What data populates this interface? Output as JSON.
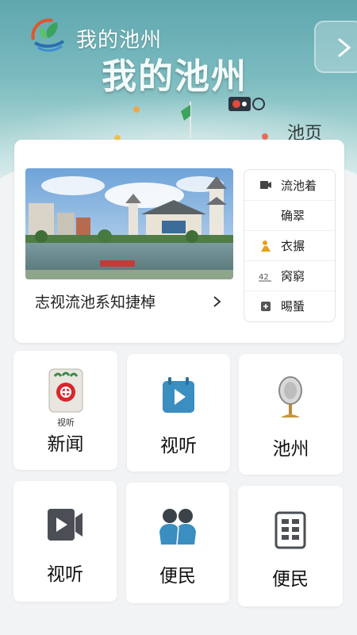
{
  "header": {
    "title_small": "我的池州",
    "title_big": "我的池州",
    "sub_title": "池页",
    "colors": {
      "sky": "#5fa7ae",
      "accent_green": "#3aa35c"
    },
    "icons": [
      "logo-icon",
      "next-arrow-icon",
      "flag-icon",
      "record-icon"
    ]
  },
  "featured": {
    "caption": "志视流池系知捷棹",
    "side_menu": [
      {
        "icon": "video-camera-icon",
        "label": "流池着"
      },
      {
        "icon": "",
        "label": "确翠"
      },
      {
        "icon": "person-icon",
        "label": "衣搌"
      },
      {
        "icon": "number-icon",
        "label": "窉窮"
      },
      {
        "icon": "plus-box-icon",
        "label": "晹蜑"
      }
    ]
  },
  "grid": [
    {
      "label": "新闻",
      "icon": "news-badge-icon",
      "icon_caption": "视听"
    },
    {
      "label": "视听",
      "icon": "play-calendar-icon"
    },
    {
      "label": "池州",
      "icon": "microphone-icon"
    },
    {
      "label": "视听",
      "icon": "video-icon"
    },
    {
      "label": "便民",
      "icon": "people-icon"
    },
    {
      "label": "便民",
      "icon": "grid-doc-icon"
    }
  ]
}
